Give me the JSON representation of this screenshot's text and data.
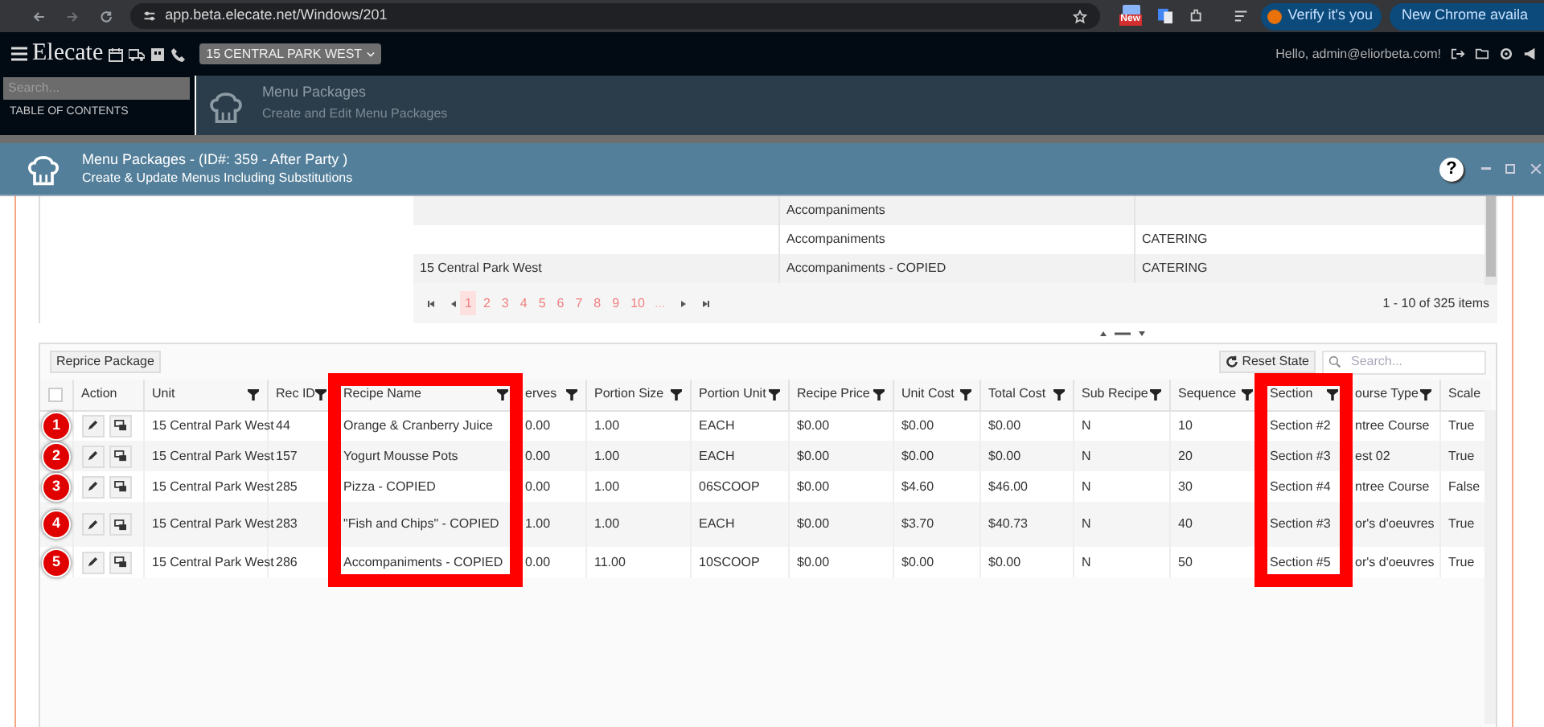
{
  "browser": {
    "url": "app.beta.elecate.net/Windows/201",
    "badge": "New",
    "chips": [
      {
        "kind": "profile",
        "label": "Verify it's you"
      },
      {
        "kind": "update",
        "label": "New Chrome availa"
      }
    ]
  },
  "app_header": {
    "logo": "Elecate",
    "location": "15 CENTRAL PARK WEST",
    "greeting": "Hello, admin@eliorbeta.com!"
  },
  "sidebar": {
    "search_placeholder": "Search...",
    "heading": "TABLE OF CONTENTS"
  },
  "page_header": {
    "title": "Menu Packages",
    "subtitle": "Create and Edit Menu Packages"
  },
  "dialog": {
    "title": "Menu Packages - (ID#: 359 - After Party )",
    "subtitle": "Create & Update Menus Including Substitutions",
    "help": "?"
  },
  "upper_grid": {
    "rows": [
      [
        "",
        "Accompaniments",
        ""
      ],
      [
        "",
        "Accompaniments",
        "CATERING"
      ],
      [
        "15 Central Park West",
        "Accompaniments - COPIED",
        "CATERING"
      ]
    ],
    "pager": {
      "pages": [
        {
          "label": "1",
          "selected": true
        },
        {
          "label": "2",
          "selected": false
        },
        {
          "label": "3",
          "selected": false
        },
        {
          "label": "4",
          "selected": false
        },
        {
          "label": "5",
          "selected": false
        },
        {
          "label": "6",
          "selected": false
        },
        {
          "label": "7",
          "selected": false
        },
        {
          "label": "8",
          "selected": false
        },
        {
          "label": "9",
          "selected": false
        },
        {
          "label": "10",
          "selected": false
        }
      ],
      "ellipsis": "...",
      "summary": "1 - 10 of 325 items"
    }
  },
  "lower_grid": {
    "toolbar": {
      "button": "Reprice Package",
      "reset": "Reset State",
      "search_placeholder": "Search..."
    },
    "select_all": {
      "checked": false
    },
    "columns": [
      {
        "label": "Action",
        "filter": false,
        "highlighted": false
      },
      {
        "label": "Unit",
        "filter": true,
        "highlighted": false
      },
      {
        "label": "Rec ID",
        "filter": true,
        "highlighted": false
      },
      {
        "label": "Recipe Name",
        "filter": true,
        "highlighted": true
      },
      {
        "label": "erves",
        "filter": true,
        "highlighted": false
      },
      {
        "label": "Portion Size",
        "filter": true,
        "highlighted": false
      },
      {
        "label": "Portion Unit",
        "filter": true,
        "highlighted": false
      },
      {
        "label": "Recipe Price",
        "filter": true,
        "highlighted": false
      },
      {
        "label": "Unit Cost",
        "filter": true,
        "highlighted": false
      },
      {
        "label": "Total Cost",
        "filter": true,
        "highlighted": false
      },
      {
        "label": "Sub Recipe",
        "filter": true,
        "highlighted": false
      },
      {
        "label": "Sequence",
        "filter": true,
        "highlighted": false
      },
      {
        "label": "Section",
        "filter": true,
        "highlighted": true
      },
      {
        "label": "ourse Type",
        "filter": true,
        "highlighted": false
      },
      {
        "label": "Scale",
        "filter": false,
        "highlighted": false
      }
    ],
    "rows": [
      {
        "marker": "1",
        "cells": [
          "",
          "15 Central Park West",
          "44",
          "Orange & Cranberry Juice",
          "0.00",
          "1.00",
          "EACH",
          "$0.00",
          "$0.00",
          "$0.00",
          "N",
          "10",
          "Section #2",
          "ntree Course",
          "True"
        ]
      },
      {
        "marker": "2",
        "cells": [
          "",
          "15 Central Park West",
          "157",
          "Yogurt Mousse Pots",
          "0.00",
          "1.00",
          "EACH",
          "$0.00",
          "$0.00",
          "$0.00",
          "N",
          "20",
          "Section #3",
          "est 02",
          "True"
        ]
      },
      {
        "marker": "3",
        "cells": [
          "",
          "15 Central Park West",
          "285",
          "Pizza - COPIED",
          "0.00",
          "1.00",
          "06SCOOP",
          "$0.00",
          "$4.60",
          "$46.00",
          "N",
          "30",
          "Section #4",
          "ntree Course",
          "False"
        ]
      },
      {
        "marker": "4",
        "cells": [
          "",
          "15 Central Park West",
          "283",
          "\"Fish and Chips\" - COPIED",
          "1.00",
          "1.00",
          "EACH",
          "$0.00",
          "$3.70",
          "$40.73",
          "N",
          "40",
          "Section #3",
          "or's d'oeuvres",
          "True"
        ]
      },
      {
        "marker": "5",
        "cells": [
          "",
          "15 Central Park West",
          "286",
          "Accompaniments - COPIED",
          "0.00",
          "11.00",
          "10SCOOP",
          "$0.00",
          "$0.00",
          "$0.00",
          "N",
          "50",
          "Section #5",
          "or's d'oeuvres",
          "True"
        ]
      }
    ]
  }
}
